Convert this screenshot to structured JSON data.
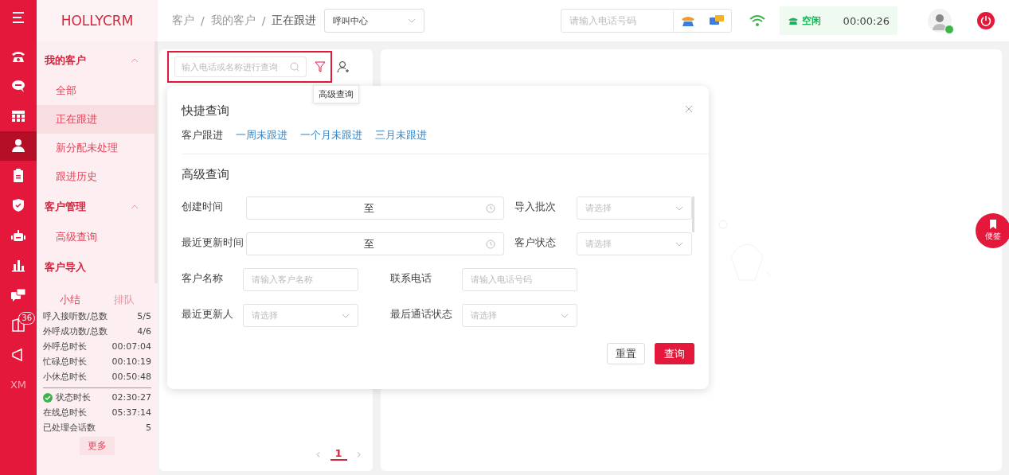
{
  "rail": {
    "items": [
      {
        "selected": false
      },
      {
        "selected": false
      },
      {
        "selected": false
      },
      {
        "selected": false
      },
      {
        "selected": true
      },
      {
        "selected": false
      },
      {
        "selected": false
      },
      {
        "selected": false
      },
      {
        "selected": false
      },
      {
        "selected": false
      },
      {
        "selected": false,
        "badge": "36"
      },
      {
        "selected": false
      },
      {
        "selected": false,
        "label": "XM"
      }
    ]
  },
  "sidebar": {
    "logo": "HOLLYCRM",
    "groups": [
      {
        "title": "我的客户",
        "expanded": true,
        "items": [
          {
            "label": "全部",
            "selected": false
          },
          {
            "label": "正在跟进",
            "selected": true
          },
          {
            "label": "新分配未处理",
            "selected": false
          },
          {
            "label": "跟进历史",
            "selected": false
          }
        ]
      },
      {
        "title": "客户管理",
        "expanded": true,
        "items": [
          {
            "label": "高级查询",
            "selected": false
          }
        ]
      },
      {
        "title": "客户导入"
      }
    ],
    "stats": {
      "tabs": [
        {
          "label": "小结",
          "selected": true
        },
        {
          "label": "排队",
          "selected": false
        }
      ],
      "rows": [
        {
          "label": "呼入接听数/总数",
          "value": "5/5"
        },
        {
          "label": "外呼成功数/总数",
          "value": "4/6"
        },
        {
          "label": "外呼总时长",
          "value": "00:07:04"
        },
        {
          "label": "忙碌总时长",
          "value": "00:10:19"
        },
        {
          "label": "小休总时长",
          "value": "00:50:48"
        }
      ],
      "status_rows": [
        {
          "label": "状态时长",
          "value": "02:30:27",
          "ok": true
        },
        {
          "label": "在线总时长",
          "value": "05:37:14",
          "ok": false
        },
        {
          "label": "已处理会话数",
          "value": "5",
          "ok": false
        }
      ],
      "more": "更多"
    }
  },
  "header": {
    "breadcrumb": [
      "客户",
      "我的客户",
      "正在跟进"
    ],
    "breadcrumb_separator": "/",
    "channel": "呼叫中心",
    "phone_placeholder": "请输入电话号码",
    "status": "空闲",
    "timer": "00:00:26"
  },
  "list_panel": {
    "search_placeholder": "输入电话或名称进行查询",
    "filter_tooltip": "高级查询",
    "page": "1",
    "prev": "‹",
    "next": "›"
  },
  "popup": {
    "quick_title": "快捷查询",
    "quick_label": "客户跟进",
    "quick_links": [
      "一周未跟进",
      "一个月未跟进",
      "三月未跟进"
    ],
    "advanced_title": "高级查询",
    "rows": [
      {
        "fields": [
          {
            "label": "创建时间",
            "kind": "daterange",
            "separator": "至"
          },
          {
            "label": "导入批次",
            "kind": "select",
            "placeholder": "请选择"
          }
        ]
      },
      {
        "fields": [
          {
            "label": "最近更新时间",
            "kind": "daterange",
            "separator": "至"
          },
          {
            "label": "客户状态",
            "kind": "select",
            "placeholder": "请选择"
          }
        ]
      },
      {
        "fields": [
          {
            "label": "客户名称",
            "kind": "text",
            "placeholder": "请输入客户名称"
          },
          {
            "label": "联系电话",
            "kind": "text",
            "placeholder": "请输入电话号码"
          }
        ]
      },
      {
        "fields": [
          {
            "label": "最近更新人",
            "kind": "select",
            "placeholder": "请选择"
          },
          {
            "label": "最后通话状态",
            "kind": "select",
            "placeholder": "请选择"
          }
        ]
      }
    ],
    "reset": "重置",
    "submit": "查询"
  },
  "note_button": "便签"
}
